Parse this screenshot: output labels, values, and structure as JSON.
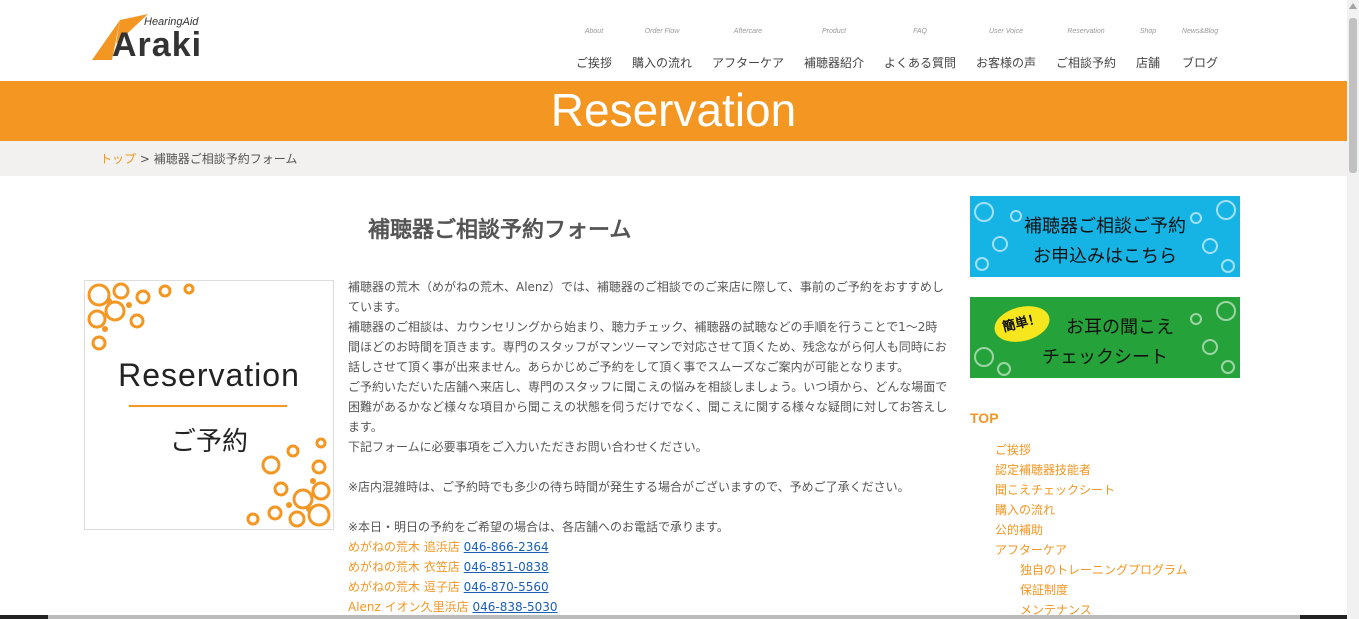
{
  "logo": {
    "tagline": "HearingAid",
    "name": "Araki"
  },
  "nav": [
    {
      "en": "About",
      "jp": "ご挨拶"
    },
    {
      "en": "Order Flow",
      "jp": "購入の流れ"
    },
    {
      "en": "Aftercare",
      "jp": "アフターケア"
    },
    {
      "en": "Product",
      "jp": "補聴器紹介"
    },
    {
      "en": "FAQ",
      "jp": "よくある質問"
    },
    {
      "en": "User Voice",
      "jp": "お客様の声"
    },
    {
      "en": "Reservation",
      "jp": "ご相談予約"
    },
    {
      "en": "Shop",
      "jp": "店舗"
    },
    {
      "en": "News&Blog",
      "jp": "ブログ"
    }
  ],
  "banner": {
    "title": "Reservation"
  },
  "breadcrumb": {
    "home": "トップ",
    "separator": ">",
    "current": "補聴器ご相談予約フォーム"
  },
  "main": {
    "title": "補聴器ご相談予約フォーム",
    "image": {
      "en": "Reservation",
      "jp": "ご予約"
    },
    "paragraphs": [
      "補聴器の荒木（めがねの荒木、Alenz）では、補聴器のご相談でのご来店に際して、事前のご予約をおすすめしています。",
      "補聴器のご相談は、カウンセリングから始まり、聴力チェック、補聴器の試聴などの手順を行うことで1〜2時間ほどのお時間を頂きます。専門のスタッフがマンツーマンで対応させて頂くため、残念ながら何人も同時にお話しさせて頂く事が出来ません。あらかじめご予約をして頂く事でスムーズなご案内が可能となります。",
      "ご予約いただいた店舗へ来店し、専門のスタッフに聞こえの悩みを相談しましょう。いつ頃から、どんな場面で困難があるかなど様々な項目から聞こえの状態を伺うだけでなく、聞こえに関する様々な疑問に対してお答えします。",
      "下記フォームに必要事項をご入力いただきお問い合わせください。"
    ],
    "note1": "※店内混雑時は、ご予約時でも多少の待ち時間が発生する場合がございますので、予めご了承ください。",
    "note2": "※本日・明日の予約をご希望の場合は、各店舗へのお電話で承ります。",
    "shops": [
      {
        "name": "めがねの荒木 追浜店",
        "tel": "046-866-2364"
      },
      {
        "name": "めがねの荒木 衣笠店",
        "tel": "046-851-0838"
      },
      {
        "name": "めがねの荒木 逗子店",
        "tel": "046-870-5560"
      },
      {
        "name": "Alenz イオン久里浜店",
        "tel": "046-838-5030"
      }
    ]
  },
  "sidebar": {
    "reserve_banner": {
      "line1": "補聴器ご相談ご予約",
      "line2": "お申込みはこちら"
    },
    "check_banner": {
      "badge": "簡単！",
      "line1": "お耳の聞こえ",
      "line2": "チェックシート"
    },
    "top_label": "TOP",
    "links": [
      {
        "label": "ご挨拶",
        "level": 1
      },
      {
        "label": "認定補聴器技能者",
        "level": 1
      },
      {
        "label": "聞こえチェックシート",
        "level": 1
      },
      {
        "label": "購入の流れ",
        "level": 1
      },
      {
        "label": "公的補助",
        "level": 1
      },
      {
        "label": "アフターケア",
        "level": 1
      },
      {
        "label": "独自のトレーニングプログラム",
        "level": 2
      },
      {
        "label": "保証制度",
        "level": 2
      },
      {
        "label": "メンテナンス",
        "level": 2
      }
    ]
  },
  "colors": {
    "accent": "#f39622",
    "reserve_banner": "#16b3e5",
    "check_banner": "#26a23a",
    "link": "#1a5fb4"
  }
}
